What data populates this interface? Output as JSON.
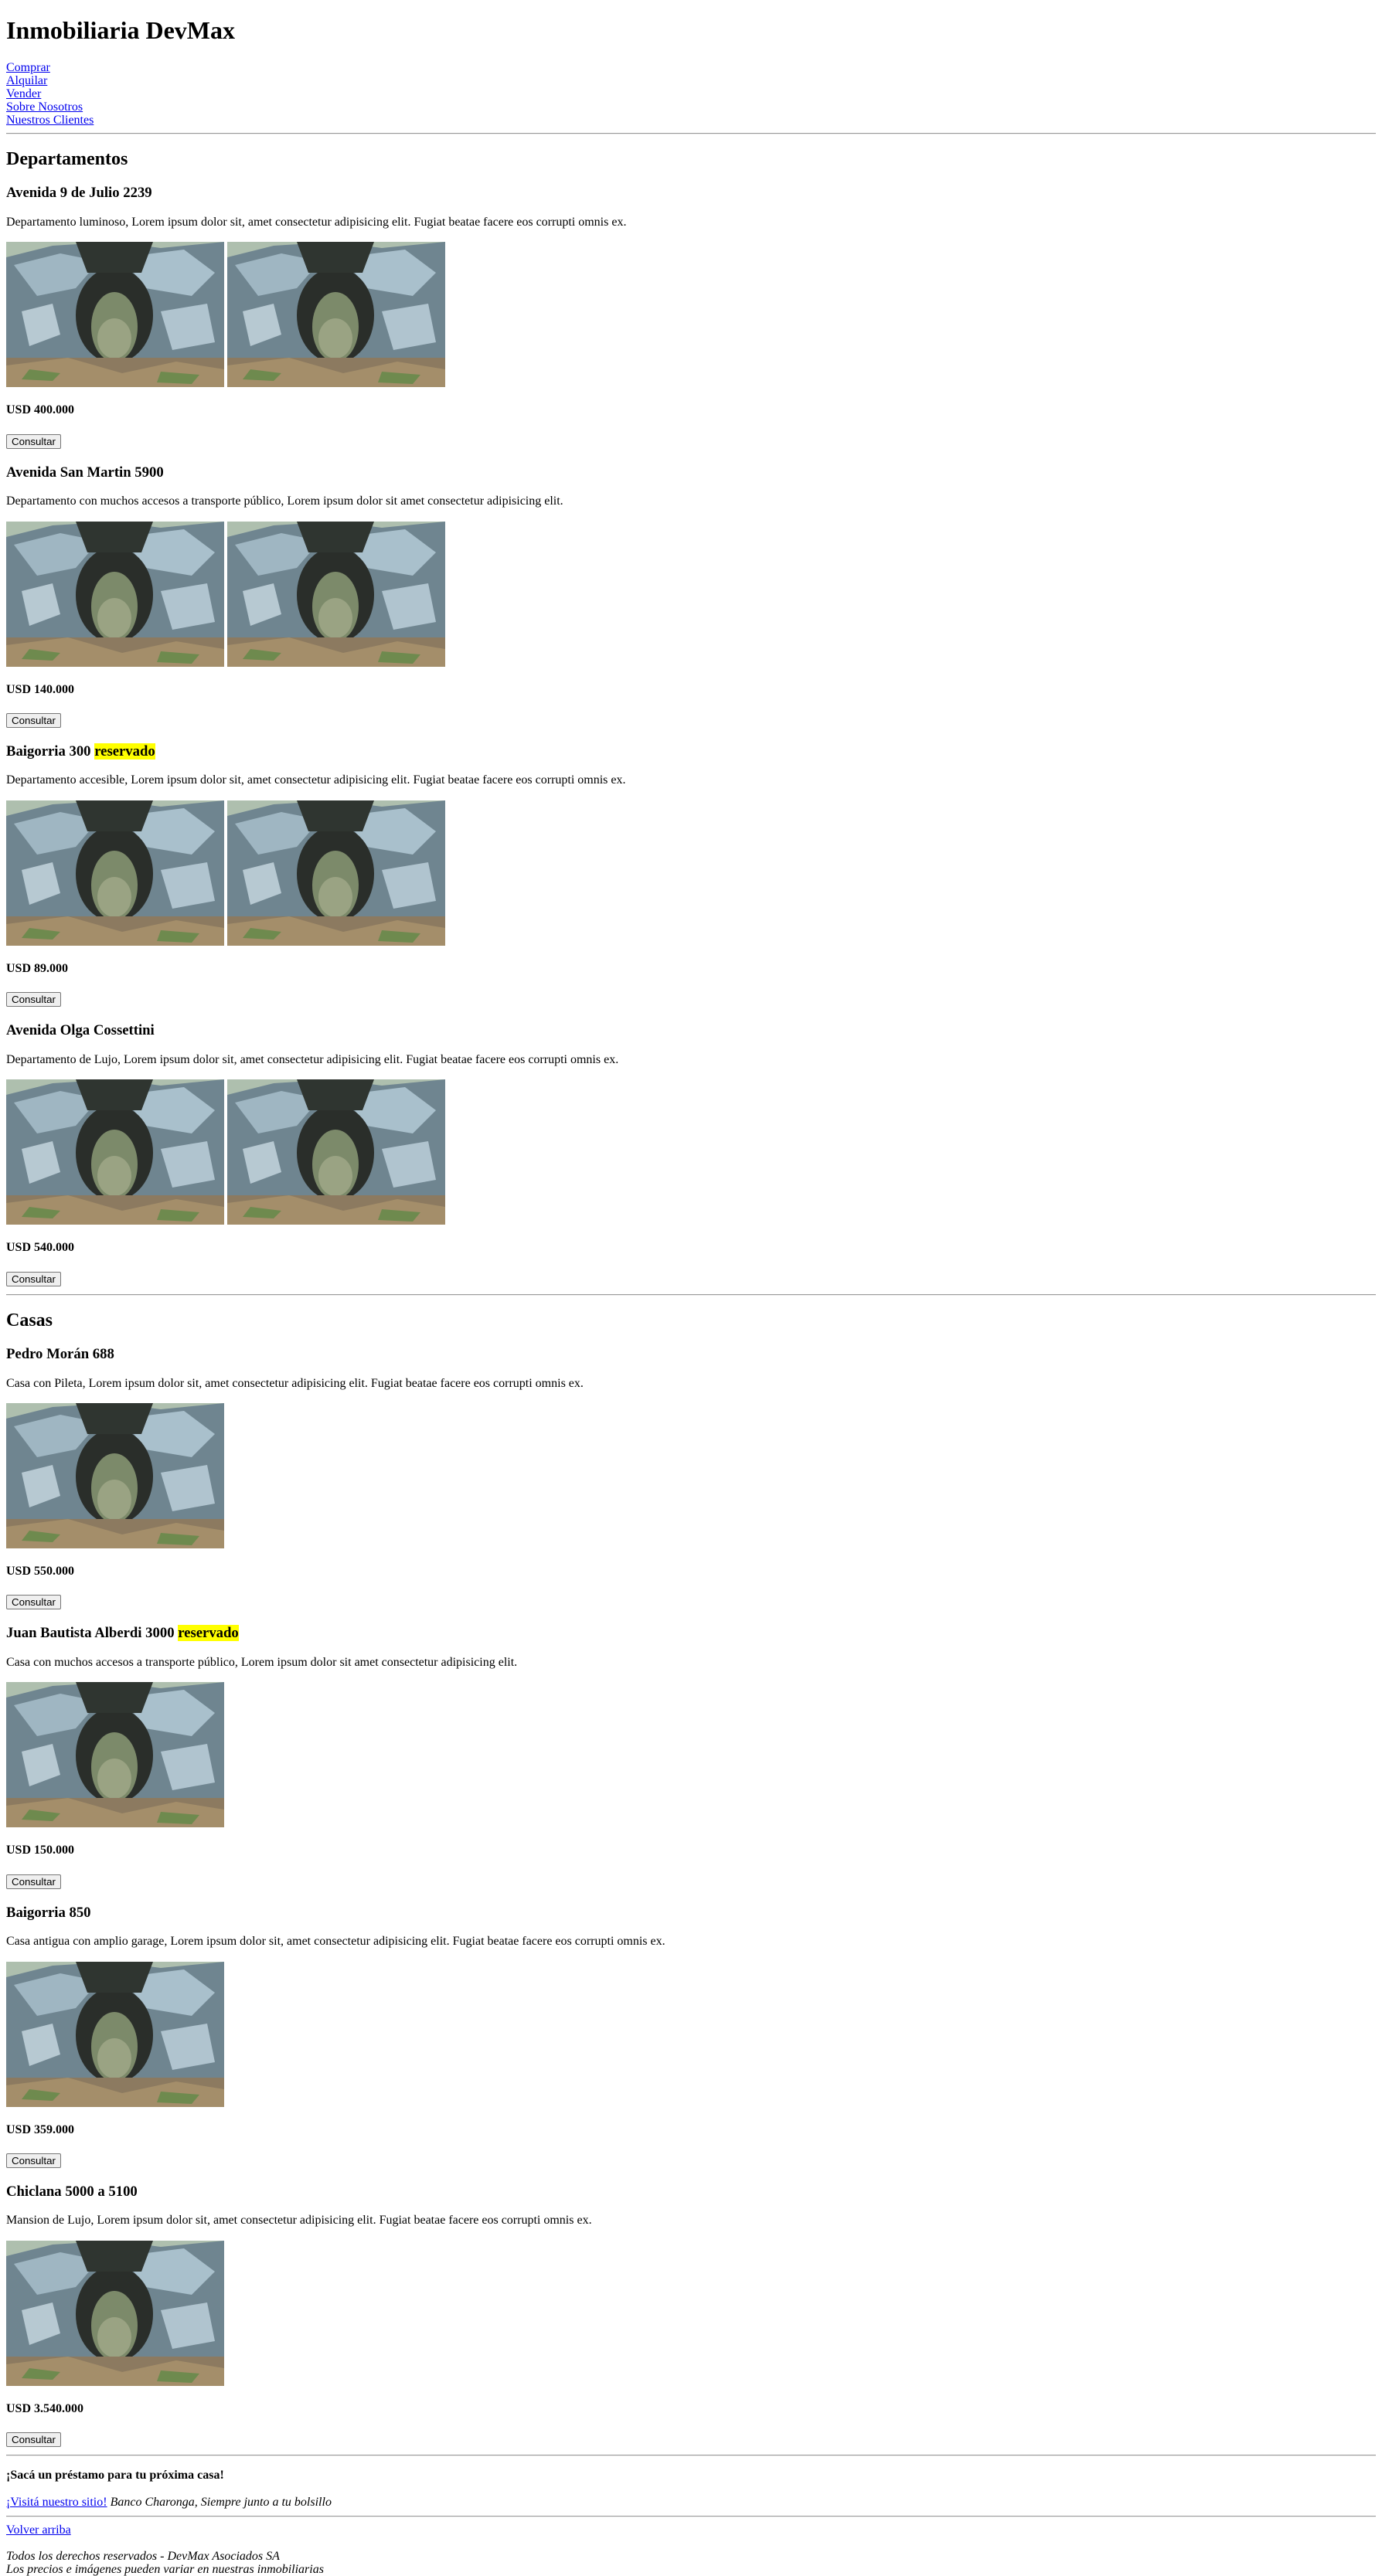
{
  "header": {
    "title": "Inmobiliaria DevMax",
    "nav": [
      "Comprar",
      "Alquilar",
      "Vender",
      "Sobre Nosotros",
      "Nuestros Clientes"
    ]
  },
  "sections": [
    {
      "title": "Departamentos",
      "properties": [
        {
          "name": "Avenida 9 de Julio 2239",
          "badge": "",
          "desc": "Departamento luminoso, Lorem ipsum dolor sit, amet consectetur adipisicing elit. Fugiat beatae facere eos corrupti omnis ex.",
          "price": "USD 400.000",
          "button": "Consultar",
          "images": 2
        },
        {
          "name": "Avenida San Martin 5900",
          "badge": "",
          "desc": "Departamento con muchos accesos a transporte público, Lorem ipsum dolor sit amet consectetur adipisicing elit.",
          "price": "USD 140.000",
          "button": "Consultar",
          "images": 2
        },
        {
          "name": "Baigorria 300",
          "badge": "reservado",
          "desc": "Departamento accesible, Lorem ipsum dolor sit, amet consectetur adipisicing elit. Fugiat beatae facere eos corrupti omnis ex.",
          "price": "USD 89.000",
          "button": "Consultar",
          "images": 2
        },
        {
          "name": "Avenida Olga Cossettini",
          "badge": "",
          "desc": "Departamento de Lujo, Lorem ipsum dolor sit, amet consectetur adipisicing elit. Fugiat beatae facere eos corrupti omnis ex.",
          "price": "USD 540.000",
          "button": "Consultar",
          "images": 2
        }
      ]
    },
    {
      "title": "Casas",
      "properties": [
        {
          "name": "Pedro Morán 688",
          "badge": "",
          "desc": "Casa con Pileta, Lorem ipsum dolor sit, amet consectetur adipisicing elit. Fugiat beatae facere eos corrupti omnis ex.",
          "price": "USD 550.000",
          "button": "Consultar",
          "images": 1
        },
        {
          "name": "Juan Bautista Alberdi 3000",
          "badge": "reservado",
          "desc": "Casa con muchos accesos a transporte público, Lorem ipsum dolor sit amet consectetur adipisicing elit.",
          "price": "USD 150.000",
          "button": "Consultar",
          "images": 1
        },
        {
          "name": "Baigorria 850",
          "badge": "",
          "desc": "Casa antigua con amplio garage, Lorem ipsum dolor sit, amet consectetur adipisicing elit. Fugiat beatae facere eos corrupti omnis ex.",
          "price": "USD 359.000",
          "button": "Consultar",
          "images": 1
        },
        {
          "name": "Chiclana 5000 a 5100",
          "badge": "",
          "desc": "Mansion de Lujo, Lorem ipsum dolor sit, amet consectetur adipisicing elit. Fugiat beatae facere eos corrupti omnis ex.",
          "price": "USD 3.540.000",
          "button": "Consultar",
          "images": 1
        }
      ]
    }
  ],
  "promo": {
    "title": "¡Sacá un préstamo para tu próxima casa!",
    "link": "¡Visitá nuestro sitio!",
    "tagline": "Banco Charonga, Siempre junto a tu bolsillo"
  },
  "back_to_top": "Volver arriba",
  "footer": {
    "line1": "Todos los derechos reservados - DevMax Asociados SA",
    "line2": "Los precios e imágenes pueden variar en nuestras inmobiliarias"
  },
  "colors": {
    "link": "#0000ee",
    "reserved_highlight": "#ffff00"
  }
}
